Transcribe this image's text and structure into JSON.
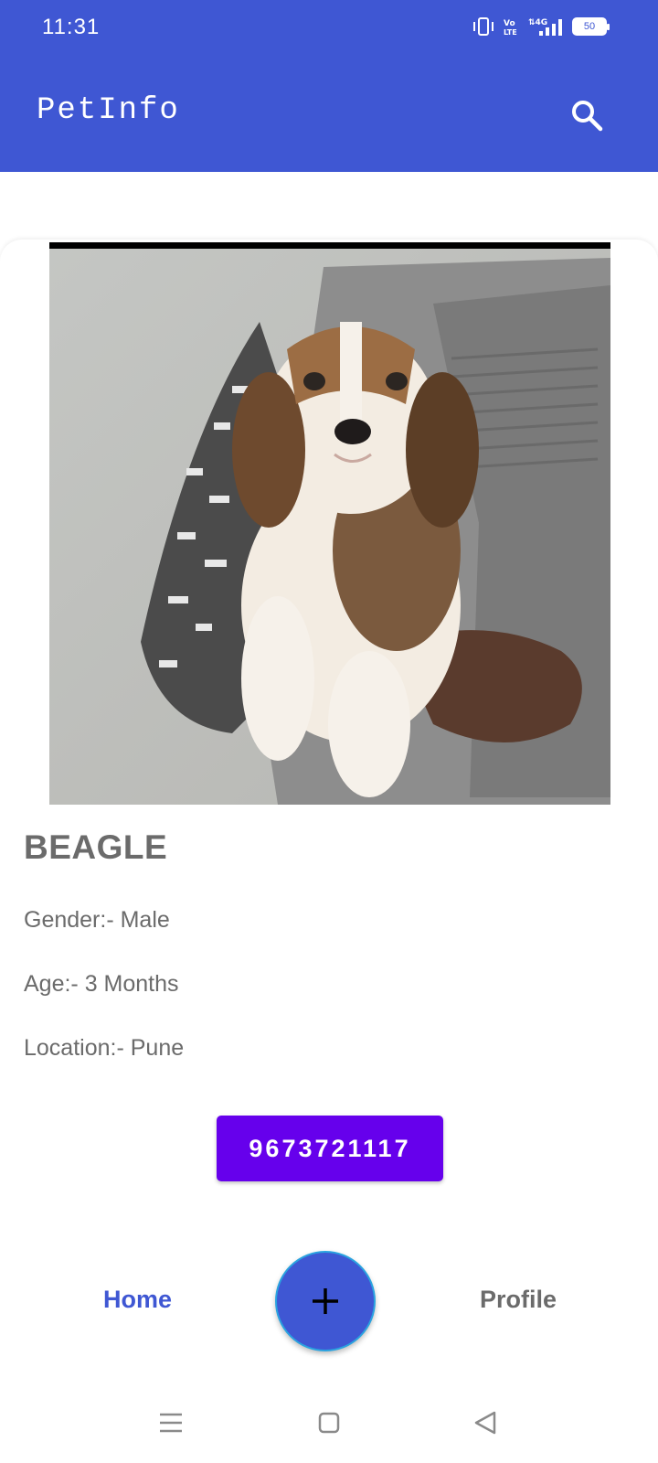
{
  "status_bar": {
    "time": "11:31",
    "battery_level": "50",
    "icons": [
      "vibrate-icon",
      "volte-icon",
      "4g-signal-icon",
      "battery-icon"
    ]
  },
  "app_bar": {
    "title": "PetInfo",
    "search_icon": "search-icon"
  },
  "pet": {
    "image_alt": "Beagle puppy held in arms",
    "name": "BEAGLE",
    "gender": "Gender:- Male",
    "age": "Age:- 3 Months",
    "location": "Location:- Pune",
    "phone": "9673721117"
  },
  "bottom_nav": {
    "home_label": "Home",
    "profile_label": "Profile",
    "fab_icon": "plus-icon"
  },
  "colors": {
    "primary": "#3f57d3",
    "accent": "#6600ec",
    "text_muted": "#6b6b6b"
  },
  "system_nav": {
    "icons": [
      "menu-icon",
      "home-square-icon",
      "back-triangle-icon"
    ]
  }
}
